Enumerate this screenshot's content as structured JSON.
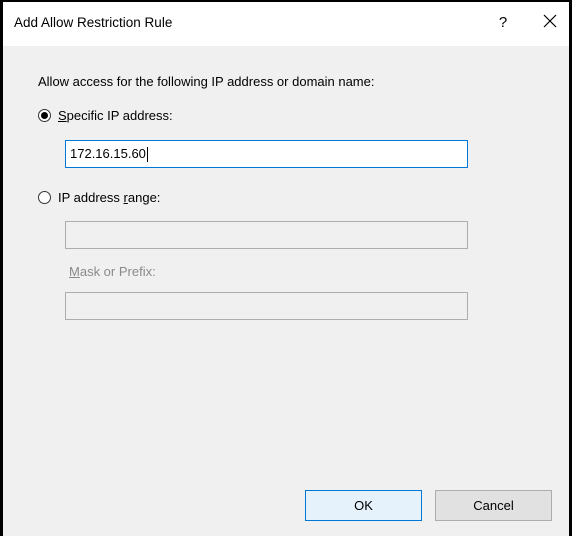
{
  "dialog": {
    "title": "Add Allow Restriction Rule",
    "help_label": "?",
    "close_icon": "close-icon"
  },
  "form": {
    "prompt": "Allow access for the following IP address or domain name:",
    "specific_ip": {
      "label_accel": "S",
      "label_rest": "pecific IP address:",
      "selected": true,
      "value": "172.16.15.60"
    },
    "ip_range": {
      "label_prefix": "IP address ",
      "label_accel": "r",
      "label_rest": "ange:",
      "selected": false,
      "value": ""
    },
    "mask": {
      "label_accel": "M",
      "label_rest": "ask or Prefix:",
      "value": ""
    }
  },
  "buttons": {
    "ok_label": "OK",
    "cancel_label": "Cancel"
  },
  "colors": {
    "focus_border": "#0078d7",
    "dialog_bg": "#f0f0f0",
    "disabled_text": "#8a8a8a"
  }
}
